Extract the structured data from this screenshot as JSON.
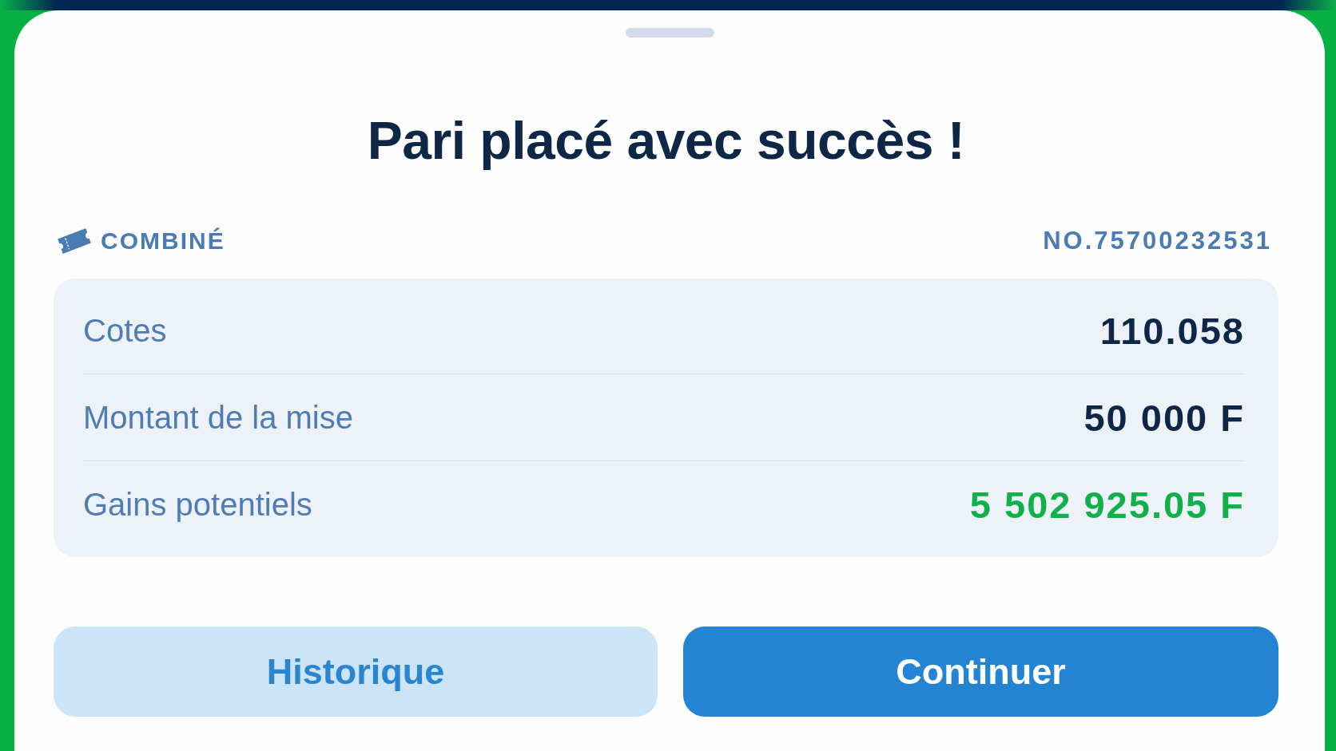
{
  "sheet": {
    "title": "Pari placé avec succès !"
  },
  "ticket": {
    "type": "COMBINÉ",
    "number": "NO.75700232531"
  },
  "summary": [
    {
      "label": "Cotes",
      "value": "110.058",
      "kind": "plain"
    },
    {
      "label": "Montant de la mise",
      "value": "50 000 F",
      "kind": "plain"
    },
    {
      "label": "Gains potentiels",
      "value": "5 502 925.05 F",
      "kind": "gain"
    }
  ],
  "buttons": [
    {
      "label": "Historique",
      "kind": "secondary"
    },
    {
      "label": "Continuer",
      "kind": "primary"
    }
  ]
}
